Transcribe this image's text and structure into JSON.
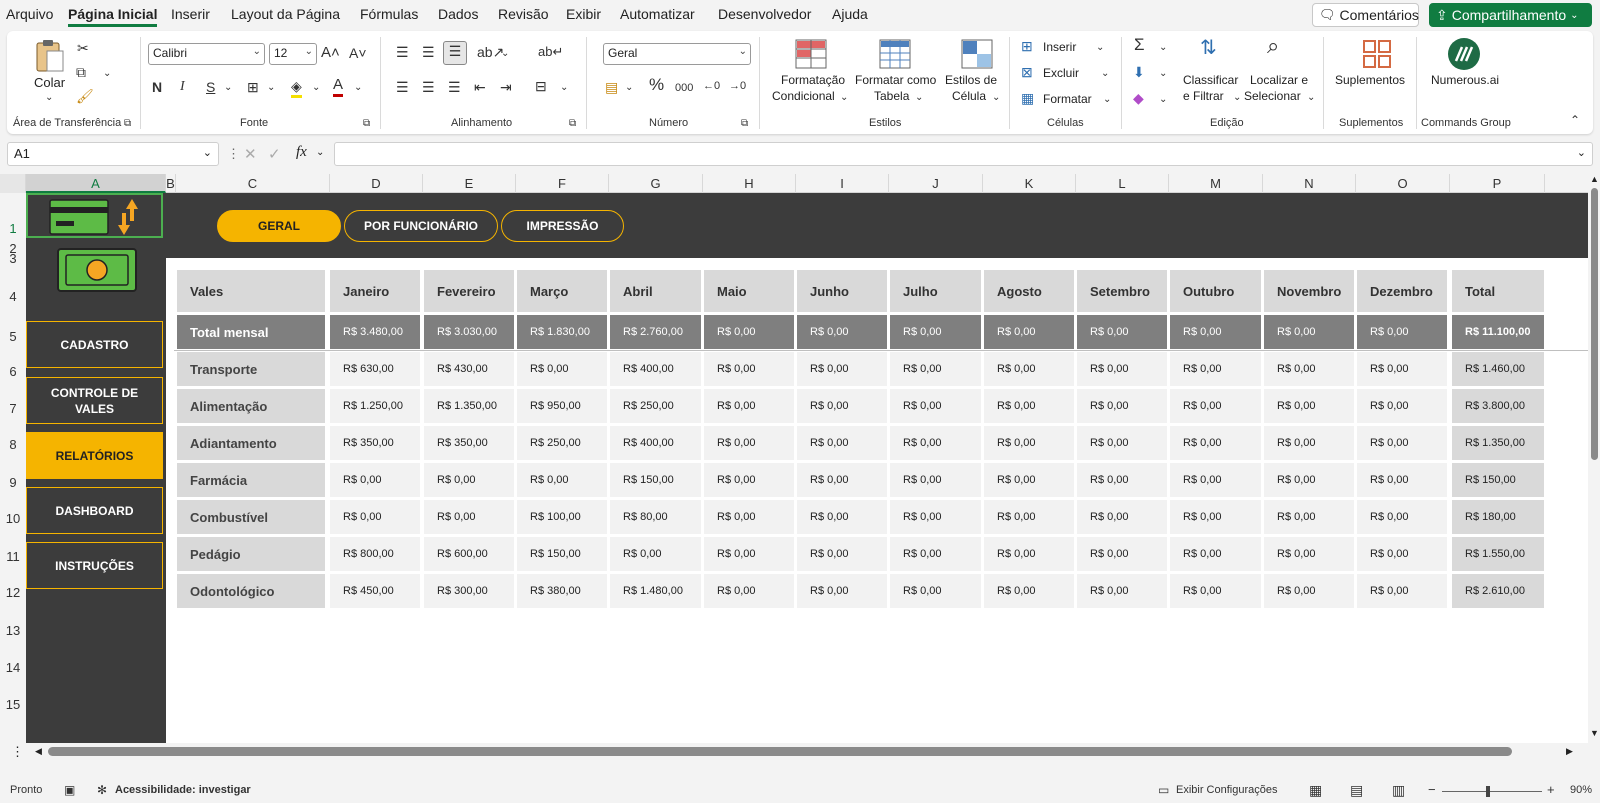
{
  "menu": {
    "items": [
      "Arquivo",
      "Página Inicial",
      "Inserir",
      "Layout da Página",
      "Fórmulas",
      "Dados",
      "Revisão",
      "Exibir",
      "Automatizar",
      "Desenvolvedor",
      "Ajuda"
    ],
    "active": "Página Inicial",
    "comments_label": "Comentários",
    "share_label": "Compartilhamento"
  },
  "ribbon": {
    "clipboard": {
      "paste_label": "Colar",
      "group_label": "Área de Transferência"
    },
    "font": {
      "font_name": "Calibri",
      "font_size": "12",
      "bold": "N",
      "italic": "I",
      "underline": "S",
      "group_label": "Fonte"
    },
    "alignment": {
      "group_label": "Alinhamento"
    },
    "number": {
      "format": "Geral",
      "percent": "%",
      "thousands": "000",
      "group_label": "Número"
    },
    "styles": {
      "conditional_line1": "Formatação",
      "conditional_line2": "Condicional",
      "table_line1": "Formatar como",
      "table_line2": "Tabela",
      "cell_line1": "Estilos de",
      "cell_line2": "Célula",
      "group_label": "Estilos"
    },
    "cells": {
      "insert_label": "Inserir",
      "delete_label": "Excluir",
      "format_label": "Formatar",
      "group_label": "Células"
    },
    "editing": {
      "sort_line1": "Classificar",
      "sort_line2": "e Filtrar",
      "find_line1": "Localizar e",
      "find_line2": "Selecionar",
      "group_label": "Edição"
    },
    "addins": {
      "label": "Suplementos",
      "group_label": "Suplementos"
    },
    "commands": {
      "label": "Numerous.ai",
      "group_label": "Commands Group"
    }
  },
  "formula_bar": {
    "cell_ref": "A1",
    "fx": "fx",
    "content": ""
  },
  "columns": [
    "A",
    "B",
    "C",
    "D",
    "E",
    "F",
    "G",
    "H",
    "I",
    "J",
    "K",
    "L",
    "M",
    "N",
    "O",
    "P"
  ],
  "rows": [
    "1",
    "2",
    "3",
    "4",
    "5",
    "6",
    "7",
    "8",
    "9",
    "10",
    "11",
    "12",
    "13",
    "14",
    "15"
  ],
  "sidebar": {
    "buttons": [
      {
        "label": "CADASTRO"
      },
      {
        "label": "CONTROLE DE VALES"
      },
      {
        "label": "RELATÓRIOS"
      },
      {
        "label": "DASHBOARD"
      },
      {
        "label": "INSTRUÇÕES"
      }
    ],
    "active": "RELATÓRIOS"
  },
  "tabs": {
    "items": [
      "GERAL",
      "POR FUNCIONÁRIO",
      "IMPRESSÃO"
    ],
    "active": "GERAL"
  },
  "report": {
    "header": [
      "Vales",
      "Janeiro",
      "Fevereiro",
      "Março",
      "Abril",
      "Maio",
      "Junho",
      "Julho",
      "Agosto",
      "Setembro",
      "Outubro",
      "Novembro",
      "Dezembro",
      "Total"
    ],
    "total_row": [
      "Total mensal",
      "R$ 3.480,00",
      "R$ 3.030,00",
      "R$ 1.830,00",
      "R$ 2.760,00",
      "R$ 0,00",
      "R$ 0,00",
      "R$ 0,00",
      "R$ 0,00",
      "R$ 0,00",
      "R$ 0,00",
      "R$ 0,00",
      "R$ 0,00",
      "R$ 11.100,00"
    ],
    "rows": [
      [
        "Transporte",
        "R$ 630,00",
        "R$ 430,00",
        "R$ 0,00",
        "R$ 400,00",
        "R$ 0,00",
        "R$ 0,00",
        "R$ 0,00",
        "R$ 0,00",
        "R$ 0,00",
        "R$ 0,00",
        "R$ 0,00",
        "R$ 0,00",
        "R$ 1.460,00"
      ],
      [
        "Alimentação",
        "R$ 1.250,00",
        "R$ 1.350,00",
        "R$ 950,00",
        "R$ 250,00",
        "R$ 0,00",
        "R$ 0,00",
        "R$ 0,00",
        "R$ 0,00",
        "R$ 0,00",
        "R$ 0,00",
        "R$ 0,00",
        "R$ 0,00",
        "R$ 3.800,00"
      ],
      [
        "Adiantamento",
        "R$ 350,00",
        "R$ 350,00",
        "R$ 250,00",
        "R$ 400,00",
        "R$ 0,00",
        "R$ 0,00",
        "R$ 0,00",
        "R$ 0,00",
        "R$ 0,00",
        "R$ 0,00",
        "R$ 0,00",
        "R$ 0,00",
        "R$ 1.350,00"
      ],
      [
        "Farmácia",
        "R$ 0,00",
        "R$ 0,00",
        "R$ 0,00",
        "R$ 150,00",
        "R$ 0,00",
        "R$ 0,00",
        "R$ 0,00",
        "R$ 0,00",
        "R$ 0,00",
        "R$ 0,00",
        "R$ 0,00",
        "R$ 0,00",
        "R$ 150,00"
      ],
      [
        "Combustível",
        "R$ 0,00",
        "R$ 0,00",
        "R$ 100,00",
        "R$ 80,00",
        "R$ 0,00",
        "R$ 0,00",
        "R$ 0,00",
        "R$ 0,00",
        "R$ 0,00",
        "R$ 0,00",
        "R$ 0,00",
        "R$ 0,00",
        "R$ 180,00"
      ],
      [
        "Pedágio",
        "R$ 800,00",
        "R$ 600,00",
        "R$ 150,00",
        "R$ 0,00",
        "R$ 0,00",
        "R$ 0,00",
        "R$ 0,00",
        "R$ 0,00",
        "R$ 0,00",
        "R$ 0,00",
        "R$ 0,00",
        "R$ 0,00",
        "R$ 1.550,00"
      ],
      [
        "Odontológico",
        "R$ 450,00",
        "R$ 300,00",
        "R$ 380,00",
        "R$ 1.480,00",
        "R$ 0,00",
        "R$ 0,00",
        "R$ 0,00",
        "R$ 0,00",
        "R$ 0,00",
        "R$ 0,00",
        "R$ 0,00",
        "R$ 0,00",
        "R$ 2.610,00"
      ]
    ]
  },
  "status": {
    "ready": "Pronto",
    "accessibility": "Acessibilidade: investigar",
    "display_settings": "Exibir Configurações",
    "zoom": "90%"
  },
  "colors": {
    "accent": "#f5b400",
    "dark": "#3c3c3c",
    "excel_green": "#107c41",
    "money_green": "#5dbb46"
  }
}
